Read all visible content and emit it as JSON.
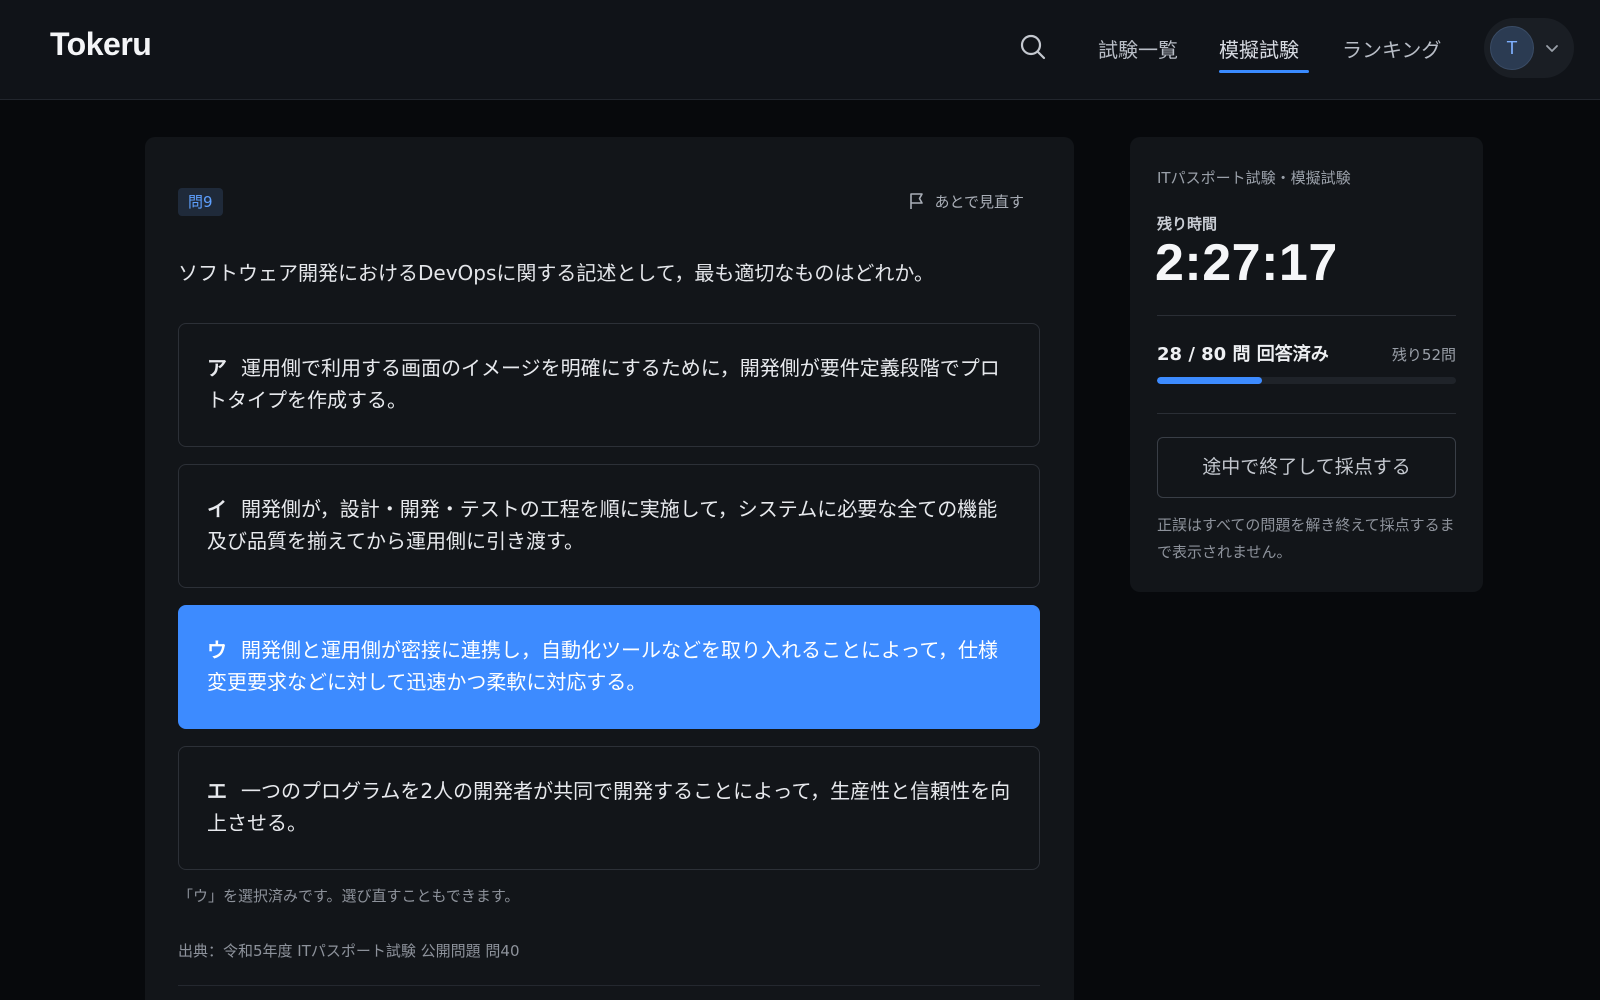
{
  "header": {
    "logo": "Tokeru",
    "nav": [
      {
        "label": "試験一覧",
        "active": false
      },
      {
        "label": "模擬試験",
        "active": true
      },
      {
        "label": "ランキング",
        "active": false
      }
    ],
    "avatar_initial": "T",
    "icons": {
      "search": "search-icon",
      "menu": "chevron-down-icon"
    },
    "accent_color": "#3a8bff"
  },
  "question": {
    "badge": "問9",
    "review_label": "あとで見直す",
    "text": "ソフトウェア開発におけるDevOpsに関する記述として，最も適切なものはどれか。",
    "choices": [
      {
        "key": "ア",
        "text": "運用側で利用する画面のイメージを明確にするために，開発側が要件定義段階でプロトタイプを作成する。",
        "selected": false
      },
      {
        "key": "イ",
        "text": "開発側が，設計・開発・テストの工程を順に実施して，システムに必要な全ての機能及び品質を揃えてから運用側に引き渡す。",
        "selected": false
      },
      {
        "key": "ウ",
        "text": "開発側と運用側が密接に連携し，自動化ツールなどを取り入れることによって，仕様変更要求などに対して迅速かつ柔軟に対応する。",
        "selected": true
      },
      {
        "key": "エ",
        "text": "一つのプログラムを2人の開発者が共同で開発することによって，生産性と信頼性を向上させる。",
        "selected": false
      }
    ],
    "selected_note": "「ウ」を選択済みです。選び直すこともできます。",
    "source": "出典：令和5年度 ITパスポート試験 公開問題 問40"
  },
  "sidebar": {
    "exam_name": "ITパスポート試験・模擬試験",
    "timer_label": "残り時間",
    "timer": "2:27:17",
    "progress_text": "28 / 80 問 回答済み",
    "remaining_text": "残り52問",
    "answered": 28,
    "total": 80,
    "finish_button": "途中で終了して採点する",
    "finish_note": "正誤はすべての問題を解き終えて採点するまで表示されません。"
  }
}
